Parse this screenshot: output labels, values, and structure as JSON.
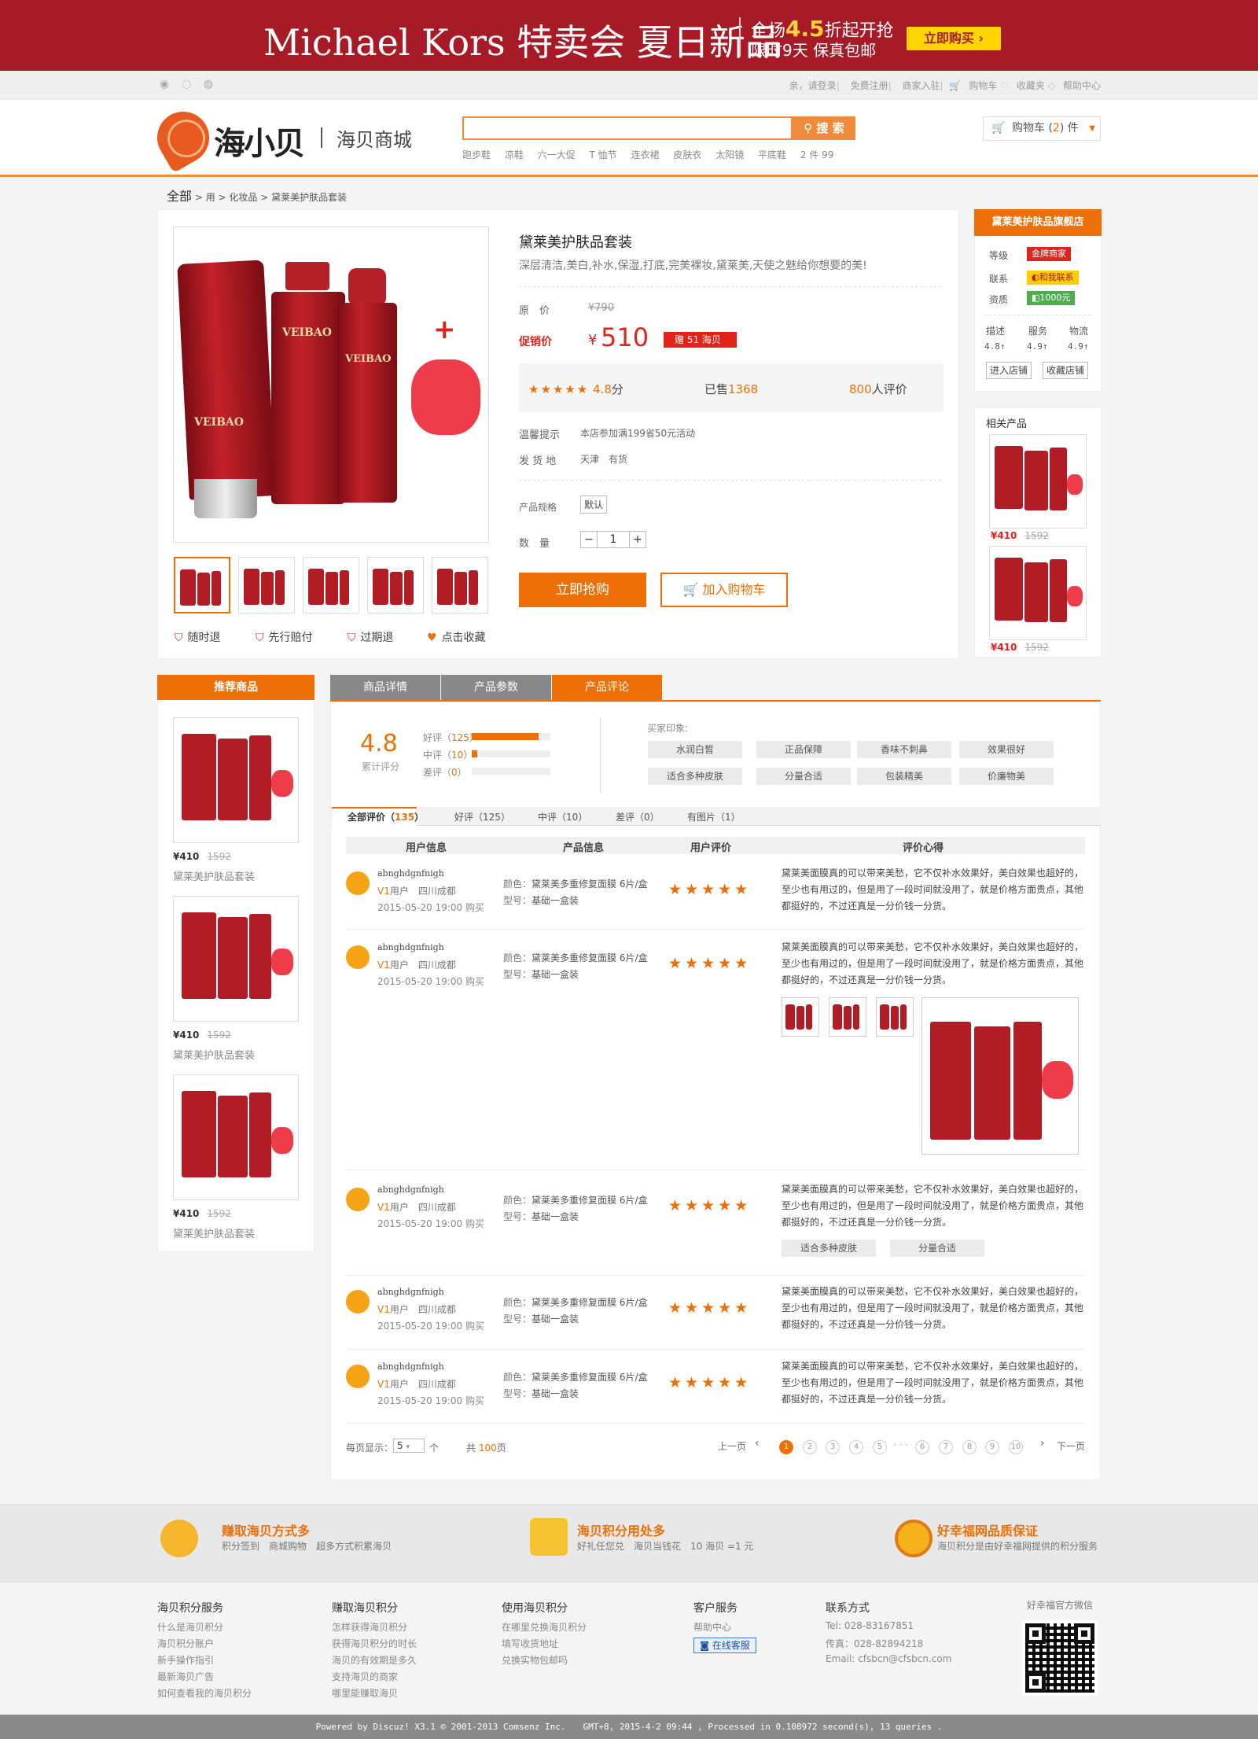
{
  "banner": {
    "brand": "Michael Kors 特卖会  夏日新品",
    "line1_pre": "全场",
    "line1_num": "4.5",
    "line1_post": "折起开抢",
    "line2": "限时9天 保真包邮",
    "button": "立即购买 ›"
  },
  "topbar": {
    "links": [
      "亲，请登录",
      "免费注册",
      "商家入驻",
      "购物车",
      "收藏夹",
      "帮助中心"
    ]
  },
  "header": {
    "logo": "海小贝",
    "logo_sub": "海贝商城",
    "search_button": "搜 索",
    "search_value": "",
    "hot_words": [
      "跑步鞋",
      "凉鞋",
      "六一大促",
      "T 恤节",
      "连衣裙",
      "皮肤衣",
      "太阳镜",
      "平底鞋",
      "2 件 99"
    ],
    "cart_pre": "购物车 (",
    "cart_count": "2",
    "cart_post": ") 件"
  },
  "breadcrumb": {
    "root": "全部",
    "items": [
      "> 用 >",
      "化妆品",
      "> 黛莱美护肤品套装"
    ]
  },
  "product": {
    "title": "黛莱美护肤品套装",
    "subtitle": "深层清洁,美白,补水,保湿,打底,完美裸妆,黛莱美,天使之魅给你想要的美!",
    "orig_label": "原　价",
    "orig_price": "¥790",
    "promo_label": "促销价",
    "currency": "¥",
    "price": "510",
    "gift_tag": "赠 51 海贝",
    "rating_stars": "★★★★★",
    "rating_value": "4.8",
    "rating_unit": "分",
    "sold_label": "已售",
    "sold": "1368",
    "review_count": "800",
    "review_unit": "人评价",
    "tip_label": "温馨提示",
    "tip": "本店参加满199省50元活动",
    "ship_label": "发 货 地",
    "ship": "天津　有货",
    "spec_label": "产品规格",
    "spec": "默认",
    "qty_label": "数　量",
    "qty": "1",
    "qty_minus": "−",
    "qty_plus": "+",
    "buy_button": "立即抢购",
    "cart_button": "加入购物车",
    "guarantees": [
      "随时退",
      "先行赔付",
      "过期退"
    ],
    "favorite": "点击收藏",
    "img_brand": "VEIBAO"
  },
  "store": {
    "name": "黛莱美护肤品旗舰店",
    "level_label": "等级",
    "level": "金牌商家",
    "contact_label": "联系",
    "contact": "和我联系",
    "qual_label": "资质",
    "qual": "1000元",
    "metrics": [
      {
        "label": "描述",
        "value": "4.8↑"
      },
      {
        "label": "服务",
        "value": "4.9↑"
      },
      {
        "label": "物流",
        "value": "4.9↑"
      }
    ],
    "enter": "进入店铺",
    "collect": "收藏店铺"
  },
  "related": {
    "title": "相关产品",
    "items": [
      {
        "price": "¥410",
        "old": "1592"
      },
      {
        "price": "¥410",
        "old": "1592"
      }
    ]
  },
  "recommend": {
    "title": "推荐商品",
    "items": [
      {
        "price": "¥410",
        "old": "1592",
        "name": "黛莱美护肤品套装"
      },
      {
        "price": "¥410",
        "old": "1592",
        "name": "黛莱美护肤品套装"
      },
      {
        "price": "¥410",
        "old": "1592",
        "name": "黛莱美护肤品套装"
      }
    ]
  },
  "tabs": [
    "商品详情",
    "产品参数",
    "产品评论"
  ],
  "summary": {
    "score": "4.8",
    "score_label": "累计评分",
    "bars": [
      {
        "label": "好评",
        "count": "125",
        "fill": 0.85
      },
      {
        "label": "中评",
        "count": "10",
        "fill": 0.07
      },
      {
        "label": "差评",
        "count": "0",
        "fill": 0
      }
    ],
    "impression_title": "买家印象:",
    "impressions": [
      "水润白皙",
      "正品保障",
      "香味不刺鼻",
      "效果很好",
      "适合多种皮肤",
      "分量合适",
      "包装精美",
      "价廉物美"
    ]
  },
  "filters": [
    {
      "label": "全部评价",
      "count": "135"
    },
    {
      "label": "好评",
      "count": "125"
    },
    {
      "label": "中评",
      "count": "10"
    },
    {
      "label": "差评",
      "count": "0"
    },
    {
      "label": "有图片",
      "count": "1"
    }
  ],
  "columns": [
    "用户信息",
    "产品信息",
    "用户评价",
    "评价心得"
  ],
  "reviews": [
    {
      "user": "abnghdgnfnigh",
      "vip": "V1",
      "loc": "用户　四川成都",
      "date": "2015-05-20 19:00 购买",
      "color": "颜色：",
      "color_val": "黛莱美多重修复面膜 6片/盒",
      "model": "型号：",
      "model_val": "基础一盒装",
      "stars": "★★★★★",
      "text": "黛莱美面膜真的可以带来美愁，它不仅补水效果好，美白效果也超好的，至少也有用过的，但是用了一段时间就没用了，就是价格方面贵点，其他都挺好的，不过还真是一分价钱一分货。"
    },
    {
      "user": "abnghdgnfnigh",
      "vip": "V1",
      "loc": "用户　四川成都",
      "date": "2015-05-20 19:00 购买",
      "color": "颜色：",
      "color_val": "黛莱美多重修复面膜 6片/盒",
      "model": "型号：",
      "model_val": "基础一盒装",
      "stars": "★★★★★",
      "text": "黛莱美面膜真的可以带来美愁，它不仅补水效果好，美白效果也超好的，至少也有用过的，但是用了一段时间就没用了，就是价格方面贵点，其他都挺好的，不过还真是一分价钱一分货。"
    },
    {
      "user": "abnghdgnfnigh",
      "vip": "V1",
      "loc": "用户　四川成都",
      "date": "2015-05-20 19:00 购买",
      "color": "颜色：",
      "color_val": "黛莱美多重修复面膜 6片/盒",
      "model": "型号：",
      "model_val": "基础一盒装",
      "stars": "★★★★★",
      "text": "黛莱美面膜真的可以带来美愁，它不仅补水效果好，美白效果也超好的，至少也有用过的，但是用了一段时间就没用了，就是价格方面贵点，其他都挺好的，不过还真是一分价钱一分货。",
      "tags": [
        "适合多种皮肤",
        "分量合适"
      ]
    },
    {
      "user": "abnghdgnfnigh",
      "vip": "V1",
      "loc": "用户　四川成都",
      "date": "2015-05-20 19:00 购买",
      "color": "颜色：",
      "color_val": "黛莱美多重修复面膜 6片/盒",
      "model": "型号：",
      "model_val": "基础一盒装",
      "stars": "★★★★★",
      "text": "黛莱美面膜真的可以带来美愁，它不仅补水效果好，美白效果也超好的，至少也有用过的，但是用了一段时间就没用了，就是价格方面贵点，其他都挺好的，不过还真是一分价钱一分货。"
    },
    {
      "user": "abnghdgnfnigh",
      "vip": "V1",
      "loc": "用户　四川成都",
      "date": "2015-05-20 19:00 购买",
      "color": "颜色：",
      "color_val": "黛莱美多重修复面膜 6片/盒",
      "model": "型号：",
      "model_val": "基础一盒装",
      "stars": "★★★★★",
      "text": "黛莱美面膜真的可以带来美愁，它不仅补水效果好，美白效果也超好的，至少也有用过的，但是用了一段时间就没用了，就是价格方面贵点，其他都挺好的，不过还真是一分价钱一分货。"
    }
  ],
  "pager": {
    "per_page_label": "每页显示：",
    "per_page": "5",
    "per_page_unit": "个",
    "total_pre": "共",
    "total": "100",
    "total_post": "页",
    "prev": "上一页",
    "next": "下一页",
    "pages": [
      "1",
      "2",
      "3",
      "4",
      "5",
      "6",
      "7",
      "8",
      "9",
      "10"
    ],
    "ellipsis": "· · ·"
  },
  "features": [
    {
      "title": "赚取海贝方式多",
      "desc": "积分签到　商城购物　超多方式积累海贝"
    },
    {
      "title": "海贝积分用处多",
      "desc": "好礼任您兑　海贝当钱花　10 海贝 =1 元"
    },
    {
      "title": "好幸福网品质保证",
      "desc": "海贝积分是由好幸福网提供的积分服务"
    }
  ],
  "footer": {
    "cols": [
      {
        "title": "海贝积分服务",
        "links": [
          "什么是海贝积分",
          "海贝积分账户",
          "新手操作指引",
          "最新海贝广告",
          "如何查看我的海贝积分"
        ]
      },
      {
        "title": "赚取海贝积分",
        "links": [
          "怎样获得海贝积分",
          "获得海贝积分的时长",
          "海贝的有效期是多久",
          "支持海贝的商家",
          "哪里能赚取海贝"
        ]
      },
      {
        "title": "使用海贝积分",
        "links": [
          "在哪里兑换海贝积分",
          "填写收货地址",
          "兑换实物包邮吗"
        ]
      },
      {
        "title": "客户服务",
        "links": [
          "帮助中心"
        ]
      },
      {
        "title": "联系方式",
        "links": [
          "Tel: 028-83167851",
          "传真：028-82894218",
          "Email: cfsbcn@cfsbcn.com"
        ]
      }
    ],
    "online": "在线客服",
    "qr_title": "好幸福官方微信"
  },
  "copyright": "Powered by Discuz! X3.1 © 2001-2013 Comsenz Inc.　　GMT+8, 2015-4-2 09:44 , Processed in 0.108972 second(s), 13 queries .",
  "colors": {
    "accent": "#ee6f07",
    "banner": "#a61b25",
    "price": "#e2231a"
  }
}
